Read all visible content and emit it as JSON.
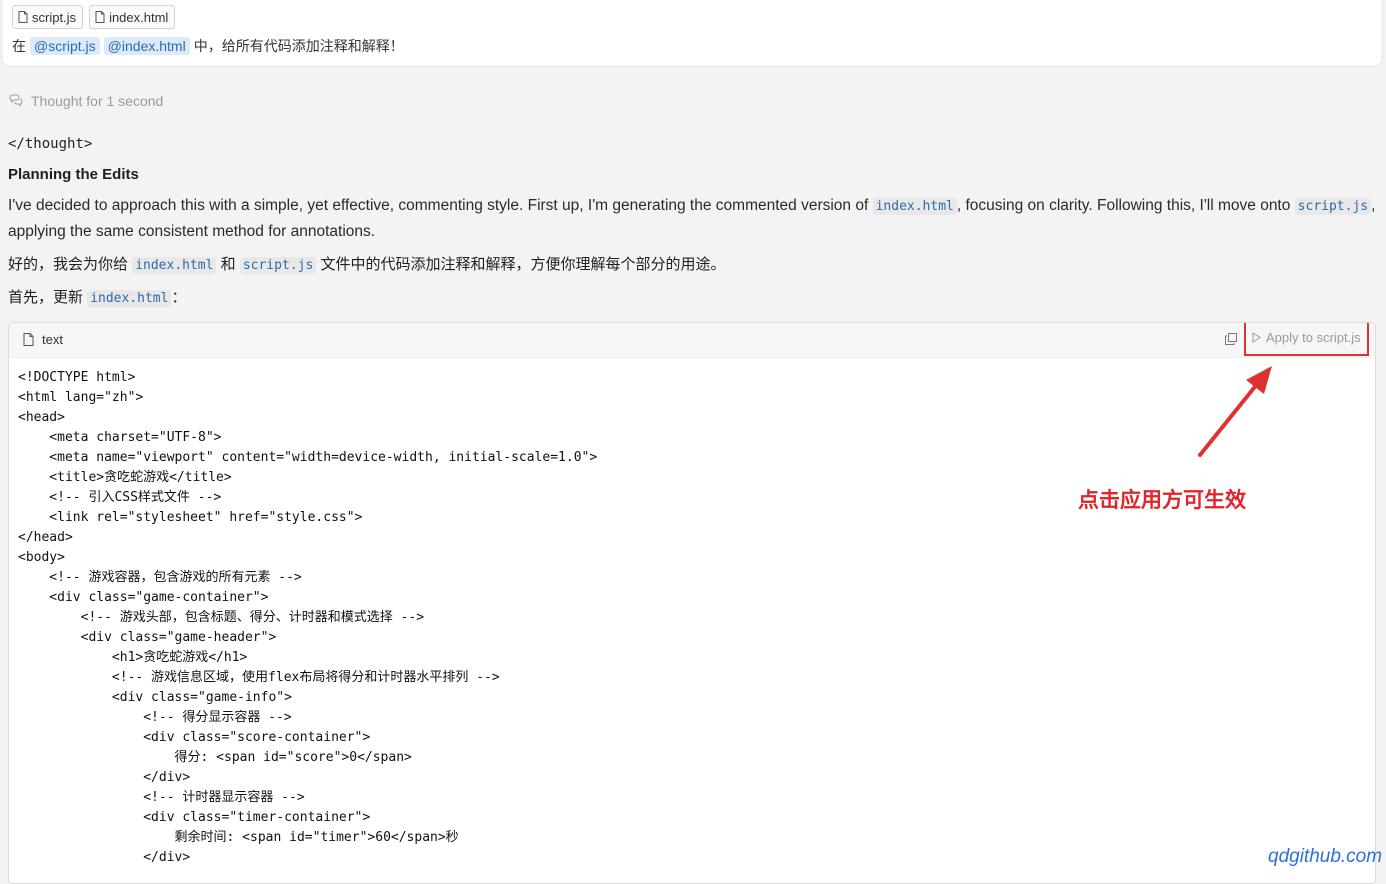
{
  "attachments": [
    "script.js",
    "index.html"
  ],
  "prompt": {
    "prefix": "在",
    "mentions": [
      "@script.js",
      "@index.html"
    ],
    "suffix": "中，给所有代码添加注释和解释！"
  },
  "thought": {
    "label": "Thought for 1 second"
  },
  "response": {
    "thought_close": "</thought>",
    "heading": "Planning the Edits",
    "para1_a": "I've decided to approach this with a simple, yet effective, commenting style. First up, I'm generating the commented version of ",
    "para1_code1": "index.html",
    "para1_b": ", focusing on clarity. Following this, I'll move onto ",
    "para1_code2": "script.js",
    "para1_c": ", applying the same consistent method for annotations.",
    "para2_a": "好的，我会为你给",
    "para2_code1": "index.html",
    "para2_b": "和",
    "para2_code2": "script.js",
    "para2_c": "文件中的代码添加注释和解释，方便你理解每个部分的用途。",
    "para3_a": "首先，更新",
    "para3_code": "index.html",
    "para3_b": "："
  },
  "code_block": {
    "language": "text",
    "apply_label": "Apply to script.js",
    "lines": [
      "<!DOCTYPE html>",
      "<html lang=\"zh\">",
      "<head>",
      "    <meta charset=\"UTF-8\">",
      "    <meta name=\"viewport\" content=\"width=device-width, initial-scale=1.0\">",
      "    <title>贪吃蛇游戏</title>",
      "    <!-- 引入CSS样式文件 -->",
      "    <link rel=\"stylesheet\" href=\"style.css\">",
      "</head>",
      "<body>",
      "    <!-- 游戏容器，包含游戏的所有元素 -->",
      "    <div class=\"game-container\">",
      "        <!-- 游戏头部，包含标题、得分、计时器和模式选择 -->",
      "        <div class=\"game-header\">",
      "            <h1>贪吃蛇游戏</h1>",
      "            <!-- 游戏信息区域，使用flex布局将得分和计时器水平排列 -->",
      "            <div class=\"game-info\">",
      "                <!-- 得分显示容器 -->",
      "                <div class=\"score-container\">",
      "                    得分: <span id=\"score\">0</span>",
      "                </div>",
      "                <!-- 计时器显示容器 -->",
      "                <div class=\"timer-container\">",
      "                    剩余时间: <span id=\"timer\">60</span>秒",
      "                </div>"
    ]
  },
  "annotation": "点击应用方可生效",
  "watermark": "qdgithub.com",
  "colors": {
    "annotation_red": "#e03131",
    "mention_bg": "#dbe9f8",
    "code_blue": "#2f6aa8"
  }
}
